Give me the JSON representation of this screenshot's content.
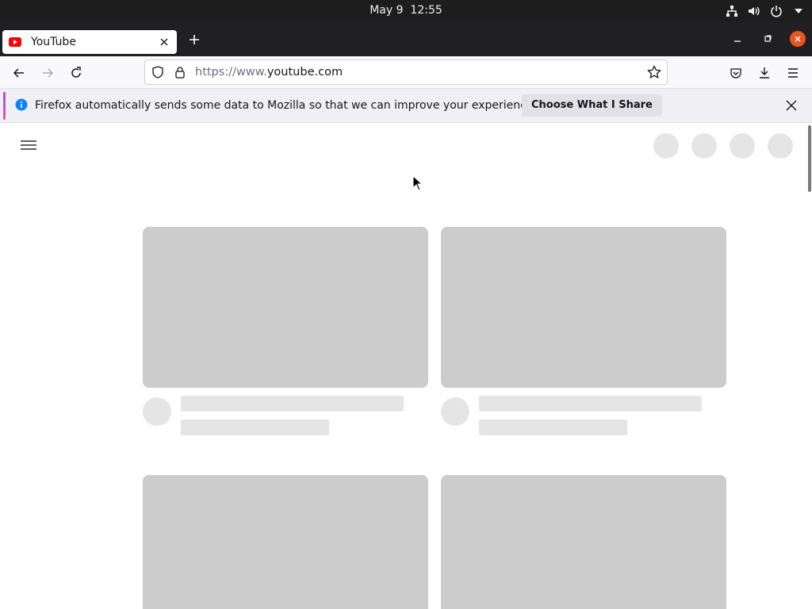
{
  "system": {
    "date": "May 9",
    "time": "12:55"
  },
  "tab": {
    "title": "YouTube"
  },
  "url": {
    "prefix": "https://www.",
    "domain": "youtube.com"
  },
  "notification": {
    "text": "Firefox automatically sends some data to Mozilla so that we can improve your experience.",
    "button_label": "Choose What I Share"
  },
  "colors": {
    "youtube_red": "#ff0000",
    "ubuntu_orange": "#e95420",
    "info_blue": "#0a84ff",
    "skeleton_thumb": "#cccccc",
    "skeleton_line": "#e5e5e5"
  },
  "icons": {
    "topbar": [
      "network-icon",
      "volume-icon",
      "power-icon",
      "dropdown-arrow-icon"
    ],
    "navbar": [
      "back-icon",
      "forward-icon",
      "reload-icon",
      "shield-icon",
      "lock-icon",
      "bookmark-star-icon",
      "pocket-icon",
      "downloads-icon",
      "app-menu-icon"
    ]
  },
  "video_cards": [
    {
      "state": "loading"
    },
    {
      "state": "loading"
    },
    {
      "state": "loading"
    },
    {
      "state": "loading"
    }
  ]
}
